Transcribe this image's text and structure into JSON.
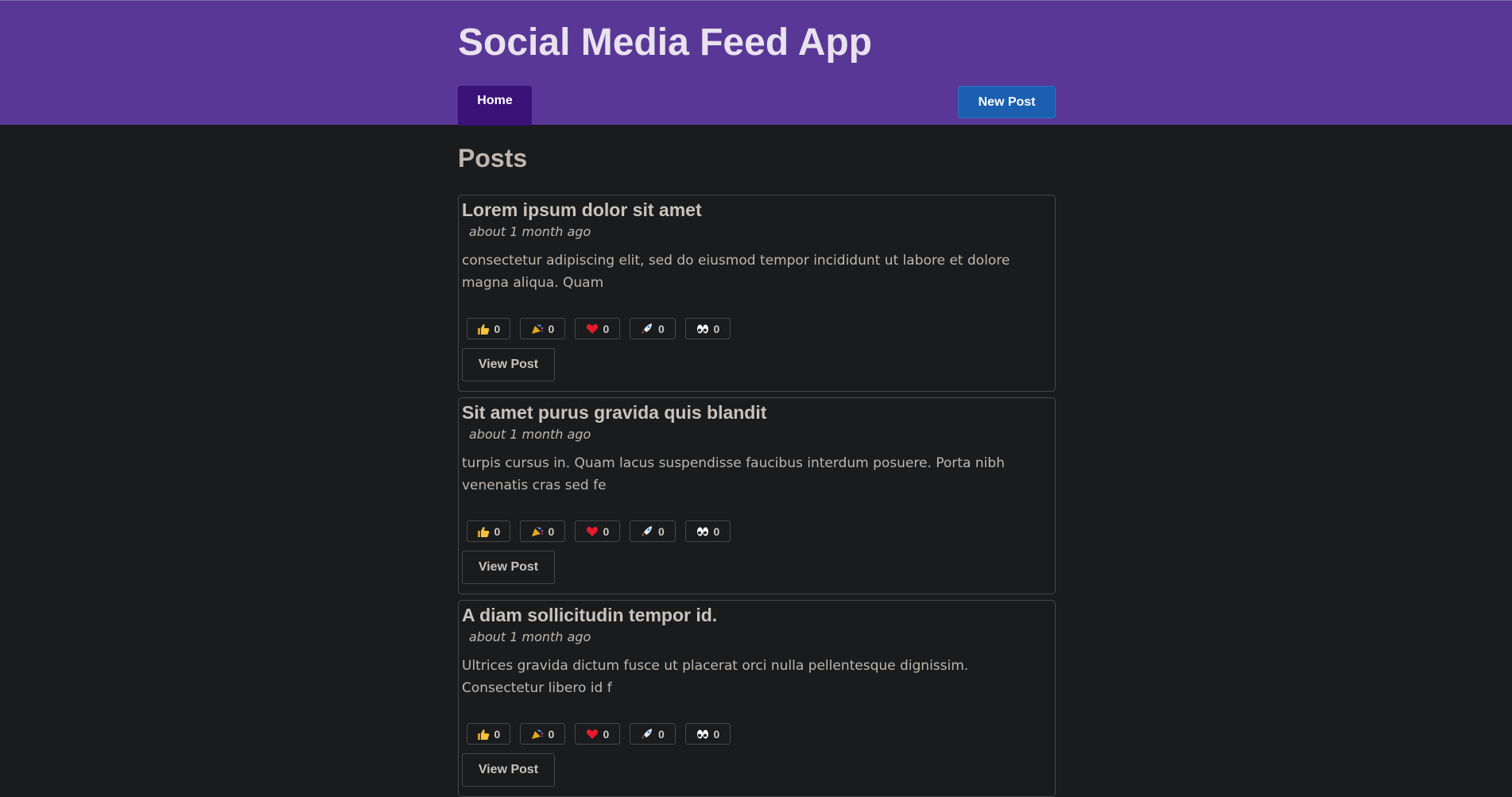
{
  "header": {
    "app_title": "Social Media Feed App",
    "nav": {
      "home_label": "Home"
    },
    "new_post_label": "New Post"
  },
  "main": {
    "heading": "Posts",
    "view_post_label": "View Post",
    "posts": [
      {
        "title": "Lorem ipsum dolor sit amet",
        "time": "about 1 month ago",
        "body": "consectetur adipiscing elit, sed do eiusmod tempor incididunt ut labore et dolore magna aliqua. Quam",
        "reactions": [
          {
            "icon": "thumbs-up-icon",
            "count": "0"
          },
          {
            "icon": "party-popper-icon",
            "count": "0"
          },
          {
            "icon": "heart-icon",
            "count": "0"
          },
          {
            "icon": "rocket-icon",
            "count": "0"
          },
          {
            "icon": "eyes-icon",
            "count": "0"
          }
        ]
      },
      {
        "title": "Sit amet purus gravida quis blandit",
        "time": "about 1 month ago",
        "body": "turpis cursus in. Quam lacus suspendisse faucibus interdum posuere. Porta nibh venenatis cras sed fe",
        "reactions": [
          {
            "icon": "thumbs-up-icon",
            "count": "0"
          },
          {
            "icon": "party-popper-icon",
            "count": "0"
          },
          {
            "icon": "heart-icon",
            "count": "0"
          },
          {
            "icon": "rocket-icon",
            "count": "0"
          },
          {
            "icon": "eyes-icon",
            "count": "0"
          }
        ]
      },
      {
        "title": "A diam sollicitudin tempor id.",
        "time": "about 1 month ago",
        "body": "Ultrices gravida dictum fusce ut placerat orci nulla pellentesque dignissim. Consectetur libero id f",
        "reactions": [
          {
            "icon": "thumbs-up-icon",
            "count": "0"
          },
          {
            "icon": "party-popper-icon",
            "count": "0"
          },
          {
            "icon": "heart-icon",
            "count": "0"
          },
          {
            "icon": "rocket-icon",
            "count": "0"
          },
          {
            "icon": "eyes-icon",
            "count": "0"
          }
        ]
      }
    ]
  },
  "colors": {
    "header_bg": "#593796",
    "nav_active_bg": "#3a1278",
    "primary_button_bg": "#1b5fb0",
    "page_bg": "#1a1b1d"
  }
}
